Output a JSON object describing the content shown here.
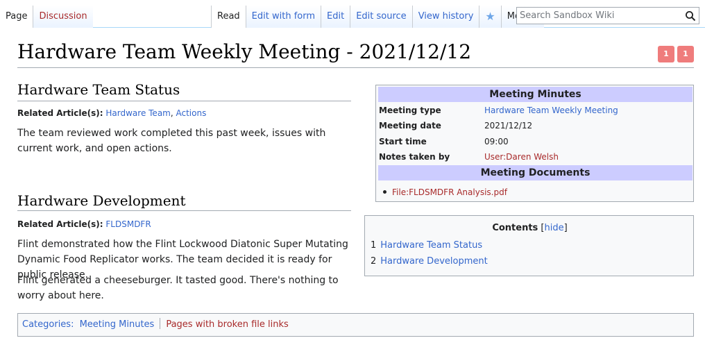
{
  "tabs": {
    "page": "Page",
    "discussion": "Discussion",
    "read": "Read",
    "edit_with_form": "Edit with form",
    "edit": "Edit",
    "edit_source": "Edit source",
    "view_history": "View history",
    "more": "More"
  },
  "search": {
    "placeholder": "Search Sandbox Wiki"
  },
  "title": "Hardware Team Weekly Meeting - 2021/12/12",
  "badges": [
    "1",
    "1"
  ],
  "sections": [
    {
      "heading": "Hardware Team Status",
      "related_label": "Related Article(s):",
      "related_links": [
        "Hardware Team",
        "Actions"
      ],
      "related_sep": ", ",
      "paragraphs": [
        "The team reviewed work completed this past week, issues with current work, and open actions."
      ]
    },
    {
      "heading": "Hardware Development",
      "related_label": "Related Article(s):",
      "related_links": [
        "FLDSMDFR"
      ],
      "paragraphs": [
        "Flint demonstrated how the Flint Lockwood Diatonic Super Mutating Dynamic Food Replicator works. The team decided it is ready for public release.",
        "Flint generated a cheeseburger. It tasted good. There's nothing to worry about here."
      ]
    }
  ],
  "infobox": {
    "heading": "Meeting Minutes",
    "rows": [
      {
        "key": "Meeting type",
        "value": "Hardware Team Weekly Meeting"
      },
      {
        "key": "Meeting date",
        "value": "2021/12/12"
      },
      {
        "key": "Start time",
        "value": "09:00"
      },
      {
        "key": "Notes taken by",
        "value": "User:Daren Welsh"
      }
    ],
    "docs_heading": "Meeting Documents",
    "docs": [
      "File:FLDSMDFR Analysis.pdf"
    ]
  },
  "toc": {
    "title": "Contents",
    "hide_open": "[",
    "hide": "hide",
    "hide_close": "]",
    "items": [
      {
        "num": "1",
        "label": "Hardware Team Status"
      },
      {
        "num": "2",
        "label": "Hardware Development"
      }
    ]
  },
  "categories": {
    "label": "Categories:",
    "items": [
      "Meeting Minutes",
      "Pages with broken file links"
    ]
  },
  "colors": {
    "link": "#3366cc",
    "redlink": "#a82a2a",
    "infobox_header": "#ccccff",
    "badge": "#ef7c7c"
  }
}
